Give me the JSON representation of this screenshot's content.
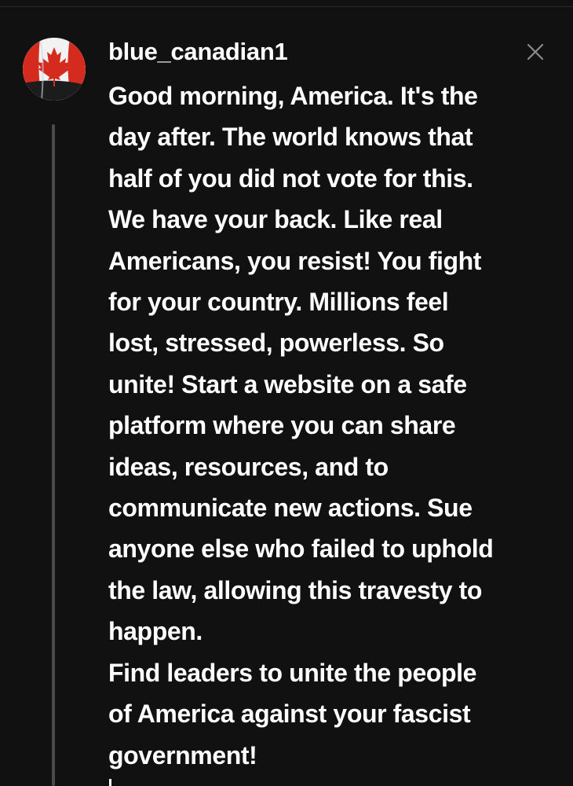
{
  "comment": {
    "username": "blue_canadian1",
    "avatar_icon": "canadian-flag-icon",
    "close_icon": "close-icon",
    "body": "Good morning, America. It's the\nday after. The world knows that\nhalf of you did not vote for this.\nWe have your back. Like real\nAmericans, you resist! You fight\nfor your country. Millions feel\nlost, stressed, powerless. So\nunite! Start a website on a safe\nplatform where you can share\nideas, resources, and to\ncommunicate new actions. Sue\nanyone else who failed to uphold\nthe law, allowing this travesty to\nhappen.\nFind leaders to unite the people\nof America against your fascist\ngovernment!"
  },
  "colors": {
    "background": "#111111",
    "text": "#ffffff",
    "thread_line": "#4a4a4a",
    "close_icon": "#8a8a8a",
    "flag_red": "#d52b1e"
  }
}
